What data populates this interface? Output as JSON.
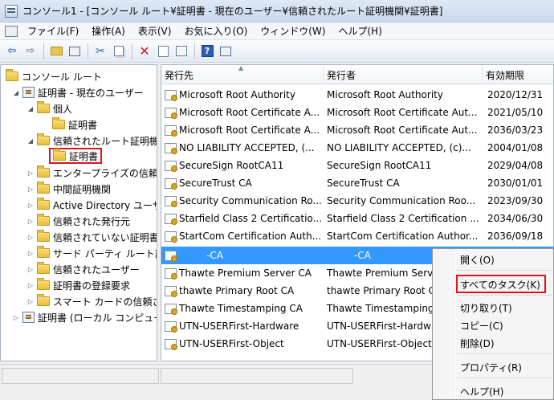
{
  "window": {
    "title": "コンソール1 - [コンソール ルート¥証明書 - 現在のユーザー¥信頼されたルート証明機関¥証明書]"
  },
  "menu": {
    "items": [
      "ファイル(F)",
      "操作(A)",
      "表示(V)",
      "お気に入り(O)",
      "ウィンドウ(W)",
      "ヘルプ(H)"
    ]
  },
  "toolbar": {
    "icons": [
      "back-arrow-icon",
      "forward-arrow-icon",
      "up-folder-icon",
      "show-hide-tree-icon",
      "cut-icon",
      "copy-icon",
      "delete-icon",
      "properties-icon",
      "export-icon",
      "help-icon",
      "show-hide-action-pane-icon"
    ]
  },
  "tree": {
    "items": [
      {
        "label": "コンソール ルート"
      },
      {
        "label": "証明書 - 現在のユーザー"
      },
      {
        "label": "個人"
      },
      {
        "label": "証明書"
      },
      {
        "label": "信頼されたルート証明機関"
      },
      {
        "label": "証明書"
      },
      {
        "label": "エンタープライズの信頼"
      },
      {
        "label": "中間証明機関"
      },
      {
        "label": "Active Directory ユーザー オブジェクト"
      },
      {
        "label": "信頼された発行元"
      },
      {
        "label": "信頼されていない証明書"
      },
      {
        "label": "サード パーティ ルート証明機関"
      },
      {
        "label": "信頼されたユーザー"
      },
      {
        "label": "証明書の登録要求"
      },
      {
        "label": "スマート カードの信頼されたルート"
      },
      {
        "label": "証明書 (ローカル コンピューター)"
      }
    ]
  },
  "list": {
    "columns": [
      "発行先",
      "発行者",
      "有効期限"
    ],
    "rows": [
      {
        "issued_to": "Microsoft Root Authority",
        "issued_by": "Microsoft Root Authority",
        "expires": "2020/12/31"
      },
      {
        "issued_to": "Microsoft Root Certificate A...",
        "issued_by": "Microsoft Root Certificate Aut...",
        "expires": "2021/05/10"
      },
      {
        "issued_to": "Microsoft Root Certificate A...",
        "issued_by": "Microsoft Root Certificate Aut...",
        "expires": "2036/03/23"
      },
      {
        "issued_to": "NO LIABILITY ACCEPTED, (...",
        "issued_by": "NO LIABILITY ACCEPTED, (c)...",
        "expires": "2004/01/08"
      },
      {
        "issued_to": "SecureSign RootCA11",
        "issued_by": "SecureSign RootCA11",
        "expires": "2029/04/08"
      },
      {
        "issued_to": "SecureTrust CA",
        "issued_by": "SecureTrust CA",
        "expires": "2030/01/01"
      },
      {
        "issued_to": "Security Communication Ro...",
        "issued_by": "Security Communication Roo...",
        "expires": "2023/09/30"
      },
      {
        "issued_to": "Starfield Class 2 Certificatio...",
        "issued_by": "Starfield Class 2 Certification ...",
        "expires": "2034/06/30"
      },
      {
        "issued_to": "StartCom Certification Auth...",
        "issued_by": "StartCom Certification Author...",
        "expires": "2036/09/18"
      },
      {
        "issued_to": "-CA",
        "issued_by": "-CA",
        "expires": ""
      },
      {
        "issued_to": "Thawte Premium Server CA",
        "issued_by": "Thawte Premium Serv",
        "expires": ""
      },
      {
        "issued_to": "thawte Primary Root CA",
        "issued_by": "thawte Primary Root C",
        "expires": ""
      },
      {
        "issued_to": "Thawte Timestamping CA",
        "issued_by": "Thawte Timestamping",
        "expires": ""
      },
      {
        "issued_to": "UTN-USERFirst-Hardware",
        "issued_by": "UTN-USERFirst-Hardw",
        "expires": ""
      },
      {
        "issued_to": "UTN-USERFirst-Object",
        "issued_by": "UTN-USERFirst-Object",
        "expires": ""
      }
    ]
  },
  "context_menu": {
    "items": [
      "開く(O)",
      "すべてのタスク(K)",
      "切り取り(T)",
      "コピー(C)",
      "削除(D)",
      "プロパティ(R)",
      "ヘルプ(H)"
    ]
  },
  "colors": {
    "selection": "#3399ff",
    "callout": "#e0141e"
  }
}
